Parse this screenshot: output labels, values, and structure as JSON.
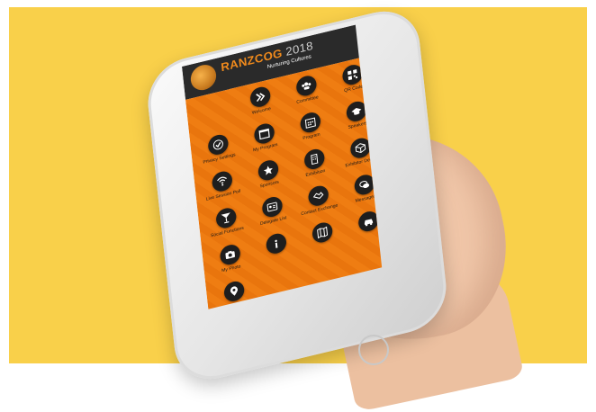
{
  "header": {
    "brand": "RANZCOG",
    "year": "2018",
    "sub_left": "",
    "sub_right": "Nurturing Cultures",
    "sub_right_line2": ""
  },
  "tiles": [
    {
      "label": "",
      "icon": "qr-code-icon"
    },
    {
      "label": "Welcome",
      "icon": "chevrons-icon"
    },
    {
      "label": "Committee",
      "icon": "group-icon"
    },
    {
      "label": "QR Code",
      "icon": "qr-code-icon"
    },
    {
      "label": "Privacy Settings",
      "icon": "check-icon"
    },
    {
      "label": "Welcome",
      "icon": "chevrons-icon"
    },
    {
      "label": "Committee",
      "icon": "group-icon"
    },
    {
      "label": "Live Session Poll",
      "icon": "wifi-icon"
    },
    {
      "label": "My Program",
      "icon": "calendar-icon"
    },
    {
      "label": "Program",
      "icon": "calendar-grid-icon"
    },
    {
      "label": "Speakers",
      "icon": "graduation-cap-icon"
    },
    {
      "label": "Live Session Poll",
      "icon": "wifi-icon"
    },
    {
      "label": "Sponsors",
      "icon": "star-icon"
    },
    {
      "label": "Exhibition",
      "icon": "building-icon"
    },
    {
      "label": "Exhibitor Details",
      "icon": "cube-icon"
    },
    {
      "label": "Social Functions",
      "icon": "cocktail-icon"
    },
    {
      "label": "Delegate List",
      "icon": "id-card-icon"
    },
    {
      "label": "Contact Exchange",
      "icon": "handshake-icon"
    },
    {
      "label": "Messages",
      "icon": "chat-icon"
    },
    {
      "label": "My Photo",
      "icon": "camera-icon"
    },
    {
      "label": "",
      "icon": "info-icon"
    },
    {
      "label": "",
      "icon": "map-icon"
    },
    {
      "label": "",
      "icon": "car-icon"
    },
    {
      "label": "",
      "icon": "location-pin-icon"
    }
  ],
  "colors": {
    "background": "#f9d04a",
    "accent": "#ef7d12",
    "header": "#2a2a2a",
    "icon_circle": "#1e1e1e"
  }
}
